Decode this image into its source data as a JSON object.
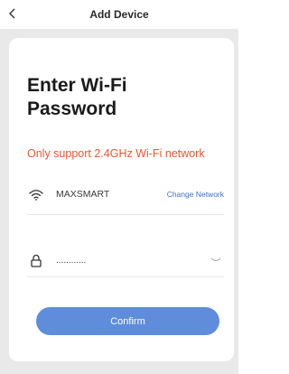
{
  "header": {
    "back_icon": "chevron-left-icon",
    "title": "Add Device"
  },
  "form": {
    "heading": "Enter Wi-Fi Password",
    "warning": "Only support 2.4GHz Wi-Fi network",
    "wifi_icon": "wifi-icon",
    "ssid": "MAXSMART",
    "change_network_label": "Change Network",
    "lock_icon": "lock-icon",
    "password_value": "............",
    "eye_icon": "eye-closed-icon",
    "confirm_label": "Confirm"
  },
  "colors": {
    "warning": "#f2542d",
    "accent": "#5f8ddb",
    "link": "#3f6fc8",
    "background": "#e9e9e9"
  }
}
